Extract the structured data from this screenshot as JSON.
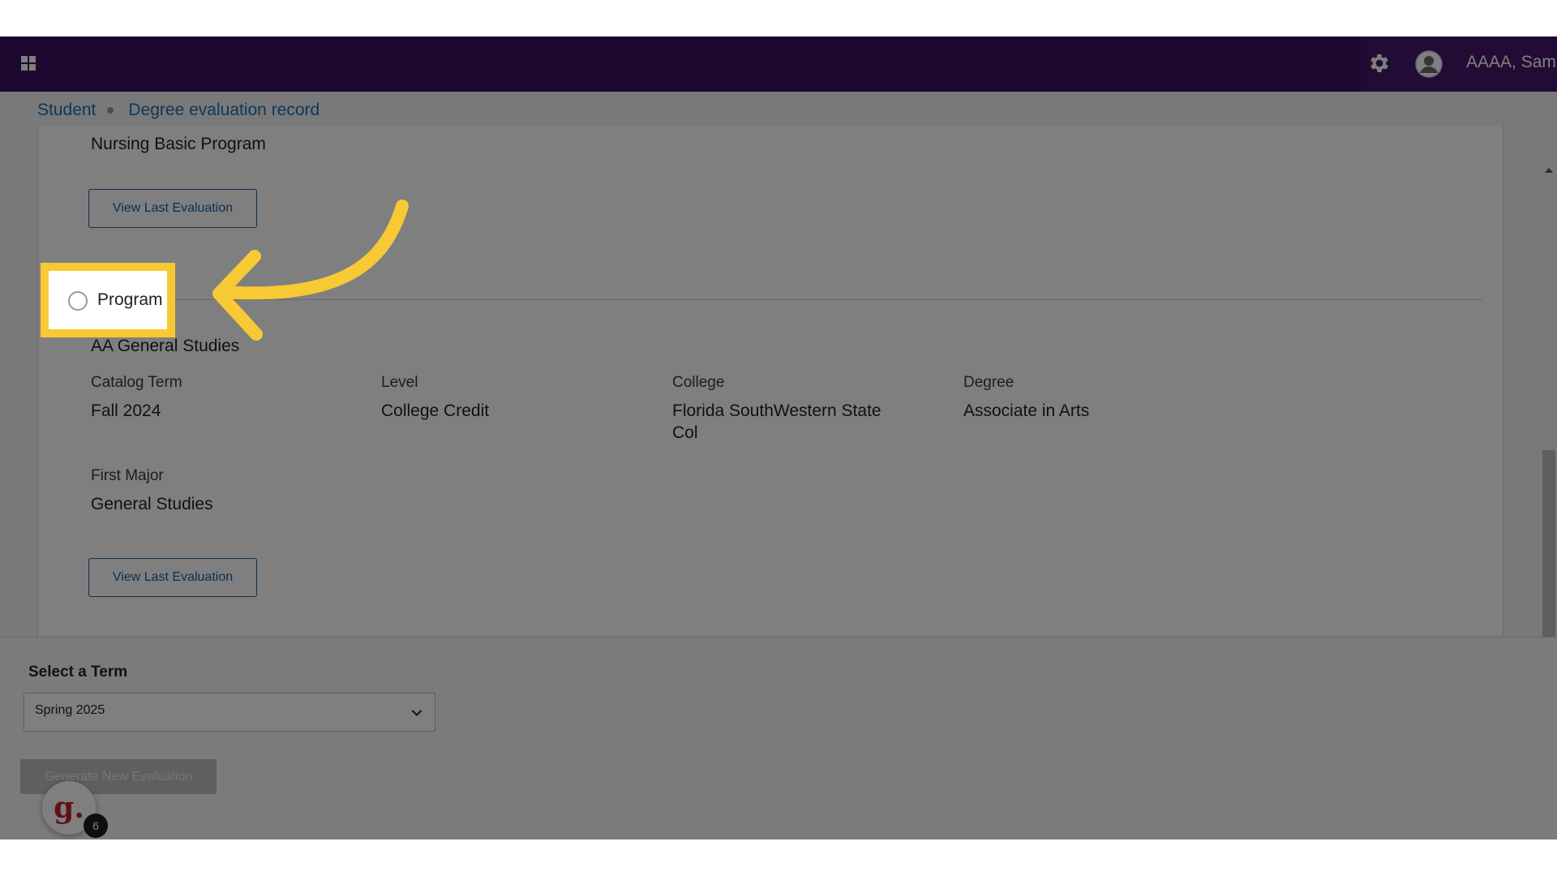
{
  "header": {
    "user_name": "AAAA, Sam",
    "icons": [
      "grid-icon",
      "gear-icon",
      "user-icon"
    ],
    "bg_color": "#3b0f5c"
  },
  "breadcrumb": {
    "items": [
      "Student",
      "Degree evaluation record"
    ]
  },
  "program1": {
    "name": "Nursing Basic Program",
    "view_button": "View Last Evaluation"
  },
  "program2": {
    "radio_label": "Program",
    "name": "AA General Studies",
    "fields": {
      "catalog_term": {
        "label": "Catalog Term",
        "value": "Fall 2024"
      },
      "level": {
        "label": "Level",
        "value": "College Credit"
      },
      "college": {
        "label": "College",
        "value_line1": "Florida SouthWestern State",
        "value_line2": "Col"
      },
      "degree": {
        "label": "Degree",
        "value": "Associate in Arts"
      },
      "first_major": {
        "label": "First Major",
        "value": "General Studies"
      }
    },
    "view_button": "View Last Evaluation"
  },
  "footer": {
    "term_label": "Select a Term",
    "term_value": "Spring 2025",
    "generate_button": "Generate New Evaluation",
    "widget_letter": "g.",
    "widget_count": "6"
  },
  "annotation": {
    "highlight_color": "#f7c935"
  }
}
